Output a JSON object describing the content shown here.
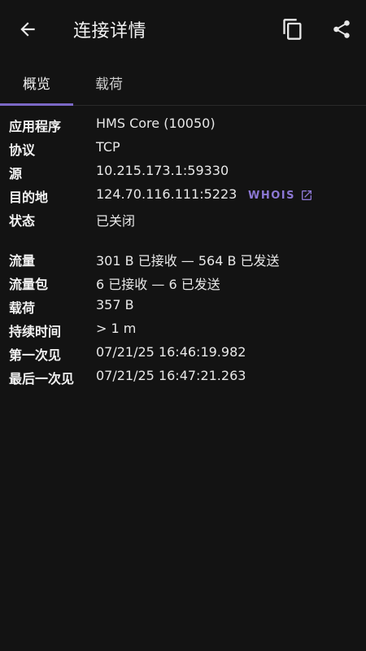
{
  "appbar": {
    "title": "连接详情",
    "back_icon": "arrow-left-icon",
    "copy_icon": "copy-icon",
    "share_icon": "share-icon"
  },
  "tabs": [
    {
      "label": "概览",
      "selected": true
    },
    {
      "label": "载荷",
      "selected": false
    }
  ],
  "details": {
    "rows": [
      {
        "label": "应用程序",
        "value": "HMS Core (10050)"
      },
      {
        "label": "协议",
        "value": "TCP"
      },
      {
        "label": "源",
        "value": "10.215.173.1:59330"
      },
      {
        "label": "目的地",
        "value": "124.70.116.111:5223"
      },
      {
        "label": "状态",
        "value": "已关闭"
      },
      {
        "label": "流量",
        "value": "301 B 已接收 — 564 B 已发送"
      },
      {
        "label": "流量包",
        "value": "6 已接收 — 6 已发送"
      },
      {
        "label": "载荷",
        "value": "357 B"
      },
      {
        "label": "持续时间",
        "value": "> 1 m"
      },
      {
        "label": "第一次见",
        "value": "07/21/25 16:46:19.982"
      },
      {
        "label": "最后一次见",
        "value": "07/21/25 16:47:21.263"
      }
    ],
    "whois_label": "WHOIS",
    "whois_icon": "open-in-new-icon"
  },
  "colors": {
    "background": "#131313",
    "accent": "#7b68c6",
    "whois": "#8c78d4"
  }
}
